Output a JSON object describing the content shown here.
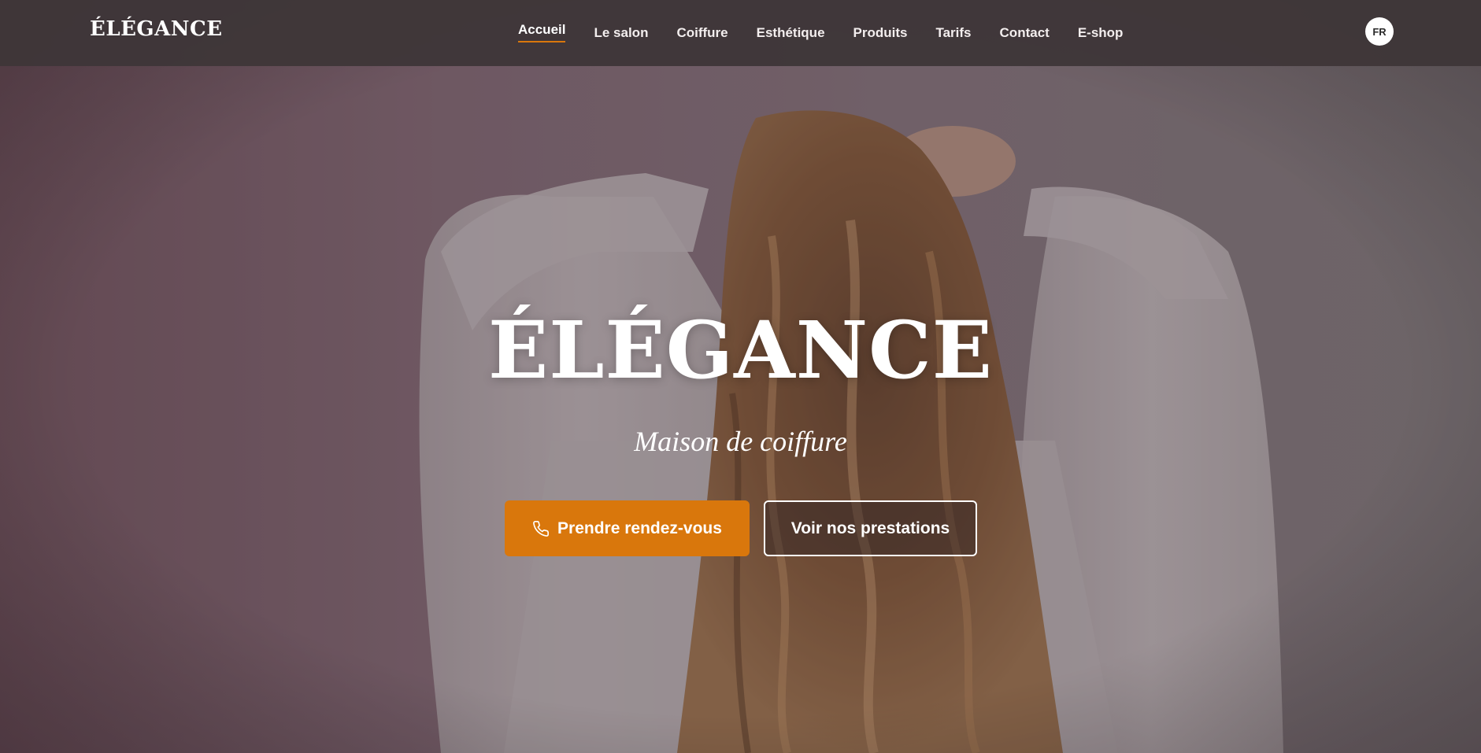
{
  "brand": {
    "logo_text": "ÉLÉGANCE"
  },
  "nav": {
    "items": [
      {
        "label": "Accueil",
        "active": true
      },
      {
        "label": "Le salon",
        "active": false
      },
      {
        "label": "Coiffure",
        "active": false
      },
      {
        "label": "Esthétique",
        "active": false
      },
      {
        "label": "Produits",
        "active": false
      },
      {
        "label": "Tarifs",
        "active": false
      },
      {
        "label": "Contact",
        "active": false
      },
      {
        "label": "E-shop",
        "active": false
      }
    ],
    "language": "FR"
  },
  "hero": {
    "title": "ÉLÉGANCE",
    "subtitle": "Maison de coiffure",
    "primary_cta": {
      "label": "Prendre rendez-vous",
      "icon": "phone-icon"
    },
    "secondary_cta": {
      "label": "Voir nos prestations"
    }
  },
  "colors": {
    "accent": "#d9770c",
    "navbar": "#3e3638",
    "text_light": "#ffffff"
  }
}
